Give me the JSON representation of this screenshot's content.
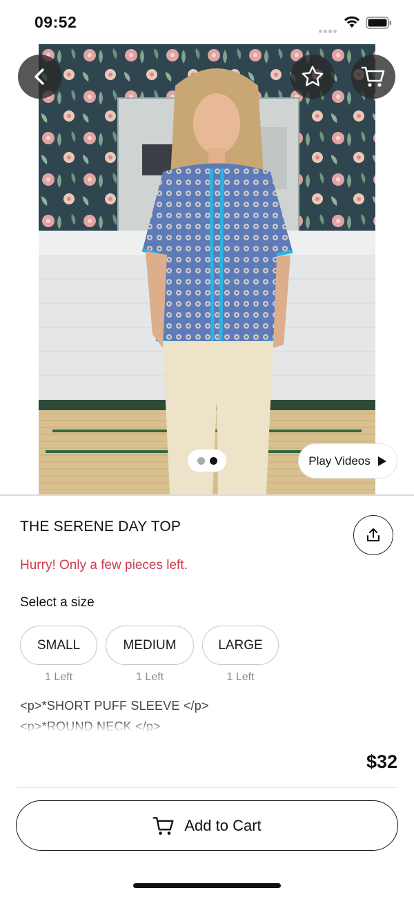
{
  "status_bar": {
    "time": "09:52"
  },
  "gallery": {
    "total_images": 2,
    "active_index": 2
  },
  "play_videos_label": "Play Videos",
  "product": {
    "title": "THE SERENE DAY TOP",
    "stock_warning": "Hurry! Only a few pieces left.",
    "size_prompt": "Select a size",
    "sizes": [
      {
        "label": "SMALL",
        "stock": "1 Left"
      },
      {
        "label": "MEDIUM",
        "stock": "1 Left"
      },
      {
        "label": "LARGE",
        "stock": "1 Left"
      }
    ],
    "description_lines": [
      "<p>*SHORT PUFF SLEEVE </p>",
      "<p>*ROUND NECK </p>"
    ]
  },
  "footer": {
    "price": "$32",
    "add_to_cart_label": "Add to Cart"
  },
  "colors": {
    "stock_warning": "#cc3a4a",
    "primary_text": "#111111",
    "secondary_text": "#8a8a8a"
  },
  "icons": {
    "back": "chevron-left-icon",
    "favorite": "star-icon",
    "cart": "cart-icon",
    "share": "share-icon",
    "play": "play-icon"
  }
}
